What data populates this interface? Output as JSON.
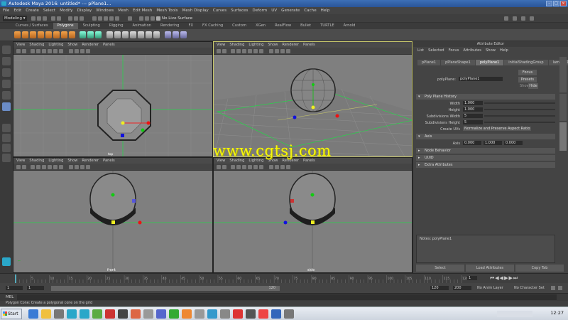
{
  "window": {
    "title": "Autodesk Maya 2016: untitled*    ---   pPlane1..."
  },
  "menubar": [
    "File",
    "Edit",
    "Create",
    "Select",
    "Modify",
    "Display",
    "Windows",
    "Mesh",
    "Edit Mesh",
    "Mesh Tools",
    "Mesh Display",
    "Curves",
    "Surfaces",
    "Deform",
    "UV",
    "Generate",
    "Cache",
    "Help"
  ],
  "status": {
    "mode": "Modeling",
    "live": "No Live Surface"
  },
  "shelf_tabs": [
    "Curves / Surfaces",
    "Polygons",
    "Sculpting",
    "Rigging",
    "Animation",
    "Rendering",
    "FX",
    "FX Caching",
    "Custom",
    "XGen",
    "RealFlow",
    "Bullet",
    "TURTLE",
    "Arnold"
  ],
  "shelf_active": "Polygons",
  "viewport_menu": [
    "View",
    "Shading",
    "Lighting",
    "Show",
    "Renderer",
    "Panels"
  ],
  "viewports": {
    "top": {
      "label": "top"
    },
    "persp": {
      "label": ""
    },
    "front": {
      "label": "front"
    },
    "side": {
      "label": "side"
    }
  },
  "attr": {
    "title": "Attribute Editor",
    "menu": [
      "List",
      "Selected",
      "Focus",
      "Attributes",
      "Show",
      "Help"
    ],
    "tabs": [
      "pPlane1",
      "pPlaneShape1",
      "polyPlane1",
      "initialShadingGroup",
      "lambert1"
    ],
    "active_tab": "polyPlane1",
    "node_label": "polyPlane:",
    "node_value": "polyPlane1",
    "focus": "Focus",
    "presets": "Presets",
    "show": "Show",
    "hide": "Hide",
    "history_section": "Poly Plane History",
    "width_label": "Width",
    "width": "1.000",
    "height_label": "Height",
    "height": "1.000",
    "subw_label": "Subdivisions Width",
    "subw": "5",
    "subh_label": "Subdivisions Height",
    "subh": "5",
    "uvs_label": "Create UVs",
    "uvs": "Normalize and Preserve Aspect Ratio",
    "axis_section": "Axis",
    "axis_label": "Axis",
    "axis": [
      "0.000",
      "1.000",
      "0.000"
    ],
    "sections": [
      "Node Behavior",
      "UUID",
      "Extra Attributes"
    ],
    "notes": "Notes: polyPlane1",
    "btn_select": "Select",
    "btn_load": "Load Attributes",
    "btn_copy": "Copy Tab",
    "side_tabs": [
      "Channel Box / Layer Editor",
      "Modeling Toolkit",
      "Attribute Editor"
    ]
  },
  "time": {
    "ticks": [
      "5",
      "10",
      "15",
      "20",
      "25",
      "30",
      "35",
      "40",
      "45",
      "50",
      "55",
      "60",
      "65",
      "70",
      "75",
      "80",
      "85",
      "90",
      "95",
      "100",
      "105",
      "110",
      "115",
      "120"
    ],
    "current": "1",
    "range_start": "1",
    "range_start2": "1",
    "range_mid": "120",
    "range_end": "120",
    "range_end2": "200",
    "anim_layer": "No Anim Layer",
    "char_set": "No Character Set"
  },
  "cmd": {
    "lang": "MEL"
  },
  "help": "Polygon Cone: Create a polygonal cone on the grid",
  "watermark": "www.cgtsj.com",
  "taskbar": {
    "start": "Start",
    "clock": "12:27"
  },
  "colors": {
    "selected_border": "#c7c76c",
    "grid": "#8c8c8c",
    "green_axis": "#27d34a",
    "watermark": "#f5f50f"
  }
}
